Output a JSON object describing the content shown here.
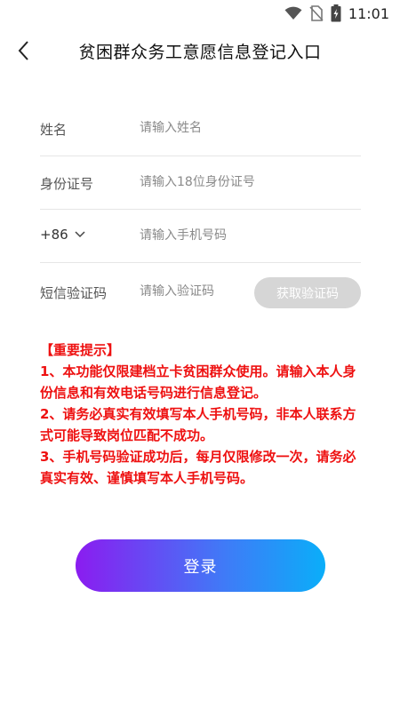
{
  "status_bar": {
    "time": "11:01"
  },
  "header": {
    "title": "贫困群众务工意愿信息登记入口"
  },
  "form": {
    "name": {
      "label": "姓名",
      "placeholder": "请输入姓名"
    },
    "id_number": {
      "label": "身份证号",
      "placeholder": "请输入18位身份证号"
    },
    "phone": {
      "country_code": "+86",
      "placeholder": "请输入手机号码"
    },
    "sms_code": {
      "label": "短信验证码",
      "placeholder": "请输入验证码",
      "button_label": "获取验证码"
    }
  },
  "notice": {
    "heading": "【重要提示】",
    "lines": [
      "1、本功能仅限建档立卡贫困群众使用。请输入本人身份信息和有效电话号码进行信息登记。",
      "2、请务必真实有效填写本人手机号码，非本人联系方式可能导致岗位匹配不成功。",
      "3、手机号码验证成功后，每月仅限修改一次，请务必真实有效、谨慎填写本人手机号码。"
    ]
  },
  "login_button": {
    "label": "登录"
  },
  "colors": {
    "notice_red": "#ee1111",
    "button_gradient_start": "#8b1cf0",
    "button_gradient_end": "#0aaef9",
    "disabled_button": "#d6d6d6"
  }
}
